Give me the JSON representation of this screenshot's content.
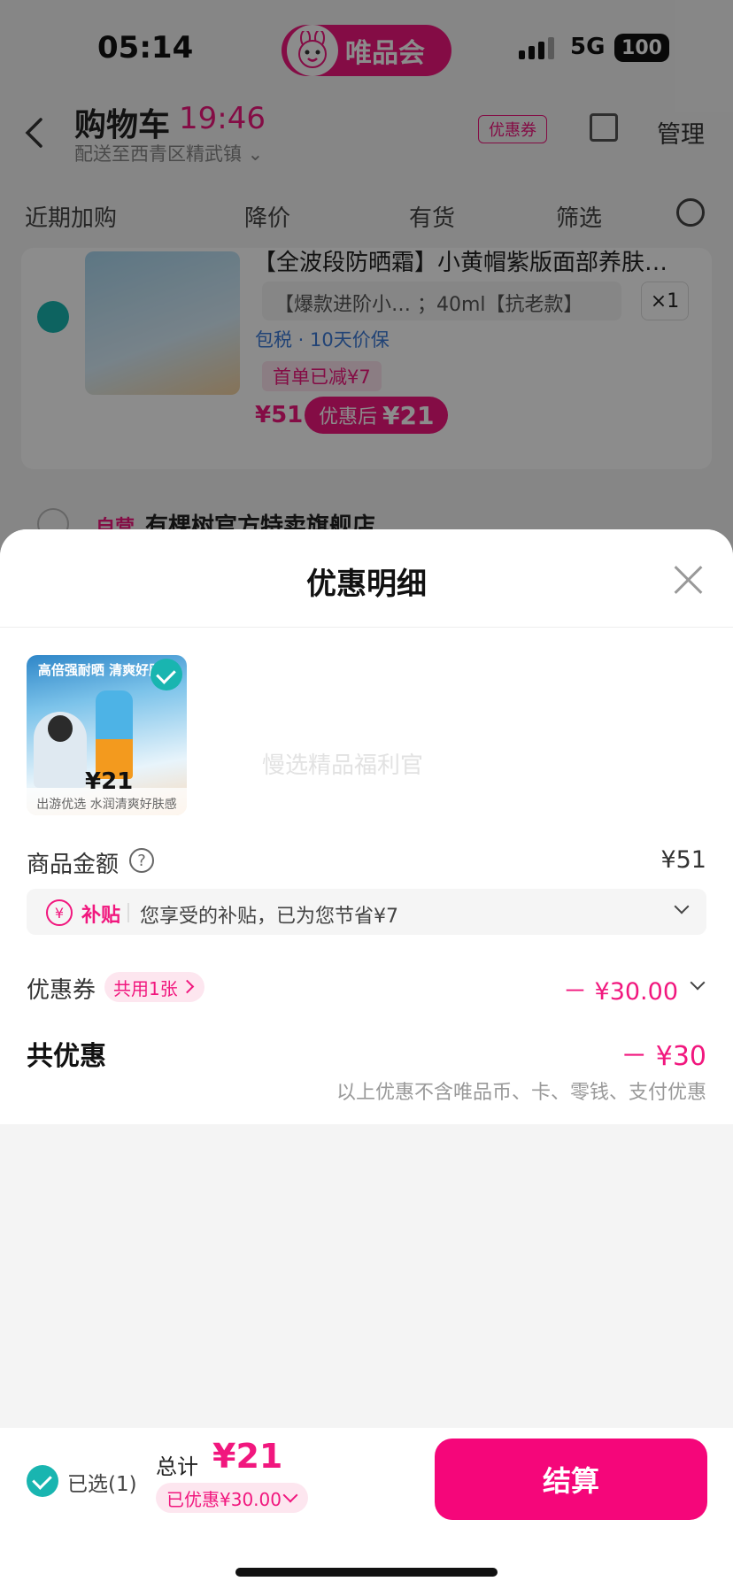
{
  "status_bar": {
    "time": "05:14",
    "network": "5G",
    "battery": "100"
  },
  "brand": {
    "name": "唯品会"
  },
  "header": {
    "title": "购物车",
    "timer": "19:46",
    "address": "配送至西青区精武镇",
    "coupon_tag": "优惠券",
    "manage": "管理"
  },
  "filter_tabs": [
    "近期加购",
    "降价",
    "有货",
    "筛选"
  ],
  "cart_item": {
    "name": "【全波段防晒霜】小黄帽紫版面部养肤…",
    "spec": "【爆款进阶小… ；40ml【抗老款】",
    "qty": "×1",
    "tax": "包税 · 10天价保",
    "promo": "首单已减¥7",
    "price": "¥51",
    "after_label": "优惠后",
    "after_price": "¥21",
    "image_caption": "出游优选 水润清爽好肤感"
  },
  "store": {
    "self_tag": "自营",
    "name": "有棵树官方特卖旗舰店"
  },
  "sheet": {
    "title": "优惠明细",
    "thumb": {
      "headline": "高倍强耐晒 清爽好肤感",
      "price": "¥21",
      "caption": "出游优选 水润清爽好肤感"
    },
    "watermark": "慢选精品福利官",
    "amount_label": "商品金额",
    "amount_value": "¥51",
    "subsidy_tag": "补贴",
    "subsidy_text": "您享受的补贴，已为您节省¥7",
    "coupon_label": "优惠券",
    "coupon_pill": "共用1张",
    "coupon_value": "－ ¥30.00",
    "total_label": "共优惠",
    "total_value": "－ ¥30",
    "total_note": "以上优惠不含唯品币、卡、零钱、支付优惠"
  },
  "bottom_bar": {
    "selected": "已选(1)",
    "sum_label": "总计",
    "sum_value": "¥21",
    "saved": "已优惠¥30.00",
    "checkout": "结算"
  }
}
